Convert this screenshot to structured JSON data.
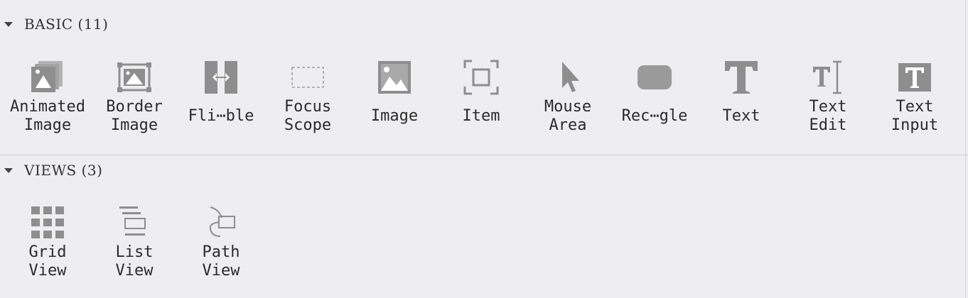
{
  "sections": {
    "basic": {
      "title": "BASIC (11)",
      "items": [
        {
          "label": "Animated\nImage",
          "icon": "animated-image-icon"
        },
        {
          "label": "Border\nImage",
          "icon": "border-image-icon"
        },
        {
          "label": "Fli⋯ble",
          "icon": "flickable-icon"
        },
        {
          "label": "Focus\nScope",
          "icon": "focus-scope-icon"
        },
        {
          "label": "Image",
          "icon": "image-icon"
        },
        {
          "label": "Item",
          "icon": "item-icon"
        },
        {
          "label": "Mouse\nArea",
          "icon": "mouse-area-icon"
        },
        {
          "label": "Rec⋯gle",
          "icon": "rectangle-icon"
        },
        {
          "label": "Text",
          "icon": "text-icon"
        },
        {
          "label": "Text\nEdit",
          "icon": "text-edit-icon"
        },
        {
          "label": "Text\nInput",
          "icon": "text-input-icon"
        }
      ]
    },
    "views": {
      "title": "VIEWS (3)",
      "items": [
        {
          "label": "Grid\nView",
          "icon": "grid-view-icon"
        },
        {
          "label": "List\nView",
          "icon": "list-view-icon"
        },
        {
          "label": "Path\nView",
          "icon": "path-view-icon"
        }
      ]
    }
  },
  "colors": {
    "background": "#eeeef0",
    "icon": "#8e8e8e",
    "icon_light": "#b4b4b4",
    "divider": "#cfcfd3"
  }
}
